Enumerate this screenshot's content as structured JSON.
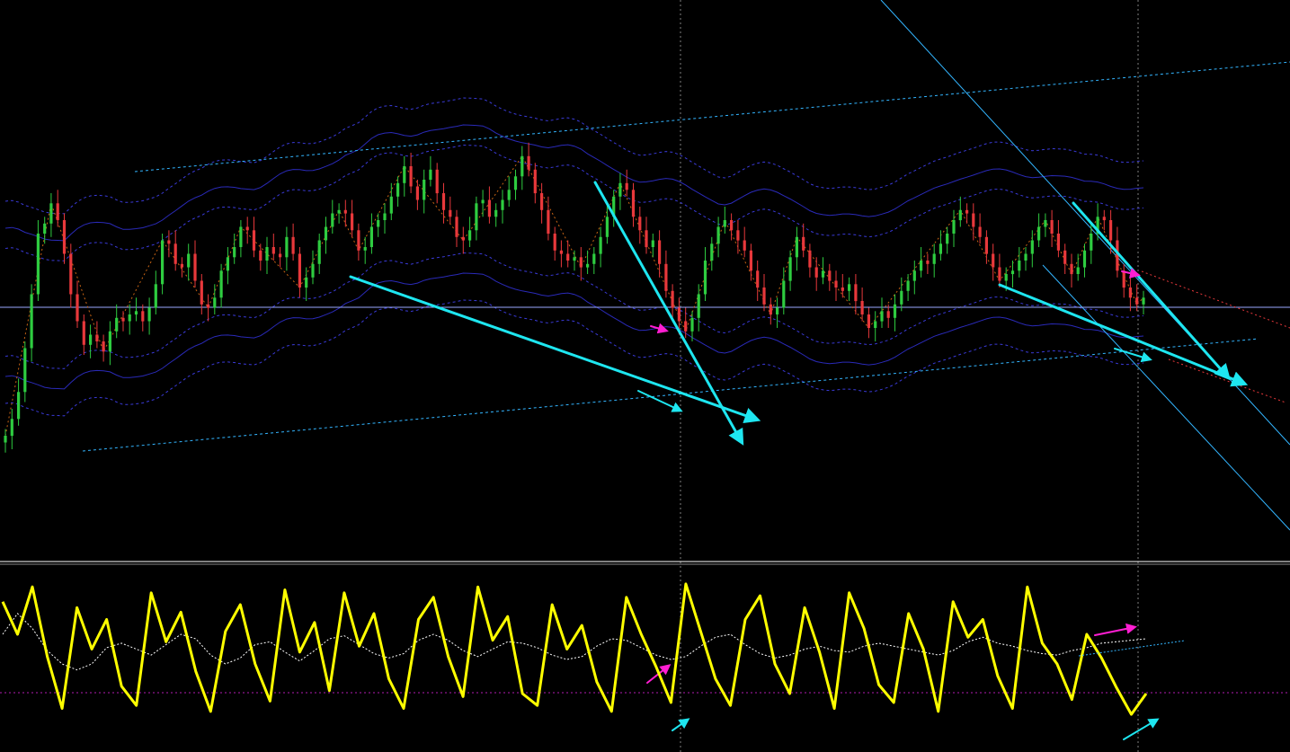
{
  "colors": {
    "background": "#000000",
    "candle_up": "#2ecc40",
    "candle_down": "#e8383b",
    "oscillator": "#ffff00",
    "oscillator_signal": "#ffffff",
    "envelope": "#2a2ab8",
    "envelope_dashed": "#3a3ad8",
    "trendline": "#33b5ff",
    "zigzag": "#c86414",
    "annotation_cyan": "#1ee6f0",
    "annotation_magenta": "#ff1ed2",
    "level_line": "#9aa8ff",
    "zero_line": "#b01db0",
    "separator": "#ffffff",
    "vgrid": "#808080"
  },
  "chart_data": [
    {
      "type": "candlestick",
      "title": "",
      "xlabel": "",
      "ylabel": "",
      "axis_labels_shown": false,
      "ylim": [
        0,
        100
      ],
      "grid": false,
      "series": [
        {
          "kind": "price_close",
          "values": [
            8,
            13,
            21,
            34,
            50,
            68,
            71,
            77,
            72,
            62,
            50,
            42,
            35,
            38,
            36,
            33,
            39,
            43,
            42,
            44,
            45,
            42,
            46,
            53,
            66,
            65,
            59,
            58,
            62,
            54,
            47,
            46,
            49,
            57,
            61,
            64,
            70,
            69,
            63,
            60,
            64,
            62,
            61,
            67,
            62,
            52,
            55,
            59,
            66,
            70,
            74,
            75,
            74,
            69,
            63,
            64,
            70,
            72,
            74,
            79,
            83,
            88,
            82,
            78,
            84,
            87,
            80,
            75,
            73,
            67,
            66,
            69,
            77,
            78,
            73,
            75,
            78,
            81,
            85,
            91,
            87,
            80,
            75,
            68,
            63,
            62,
            60,
            61,
            58,
            59,
            62,
            67,
            73,
            79,
            83,
            81,
            73,
            69,
            64,
            66,
            59,
            51,
            46,
            42,
            39,
            43,
            50,
            60,
            65,
            70,
            72,
            69,
            66,
            63,
            57,
            52,
            47,
            44,
            46,
            54,
            61,
            67,
            63,
            58,
            55,
            57,
            54,
            52,
            51,
            53,
            48,
            44,
            40,
            42,
            45,
            43,
            47,
            51,
            54,
            57,
            60,
            59,
            62,
            65,
            68,
            72,
            75,
            74,
            70,
            67,
            62,
            58,
            54,
            56,
            57,
            60,
            62,
            66,
            70,
            72,
            68,
            63,
            59,
            56,
            58,
            63,
            68,
            73,
            72,
            66,
            57,
            52,
            49,
            47,
            49
          ]
        },
        {
          "kind": "oscillator",
          "range": [
            0,
            100
          ],
          "values": [
            82,
            60,
            92,
            45,
            10,
            78,
            50,
            70,
            25,
            12,
            88,
            55,
            75,
            35,
            8,
            62,
            80,
            40,
            15,
            90,
            48,
            68,
            22,
            88,
            52,
            74,
            30,
            10,
            70,
            85,
            45,
            18,
            92,
            56,
            72,
            20,
            12,
            80,
            50,
            66,
            28,
            8,
            85,
            60,
            38,
            14,
            94,
            62,
            30,
            12,
            70,
            86,
            40,
            20,
            78,
            48,
            10,
            88,
            64,
            26,
            14,
            74,
            50,
            8,
            82,
            58,
            70,
            32,
            10,
            92,
            54,
            40,
            16,
            60,
            44,
            24,
            6,
            20
          ]
        },
        {
          "kind": "oscillator_signal",
          "range": [
            0,
            100
          ],
          "values": [
            60,
            74,
            64,
            49,
            40,
            36,
            40,
            51,
            54,
            50,
            46,
            53,
            60,
            57,
            46,
            40,
            44,
            53,
            55,
            48,
            42,
            49,
            57,
            59,
            53,
            47,
            44,
            47,
            56,
            60,
            56,
            49,
            45,
            50,
            55,
            54,
            51,
            46,
            43,
            45,
            52,
            57,
            56,
            51,
            46,
            43,
            45,
            52,
            58,
            60,
            53,
            47,
            44,
            46,
            50,
            52,
            49,
            48,
            52,
            54,
            52,
            50,
            48,
            46,
            49,
            55,
            58,
            54,
            52,
            49,
            47,
            46,
            49,
            51,
            54,
            55,
            56,
            57
          ]
        }
      ],
      "annotations": {
        "cyan_arrows": 8,
        "magenta_arrows": 4
      }
    }
  ]
}
